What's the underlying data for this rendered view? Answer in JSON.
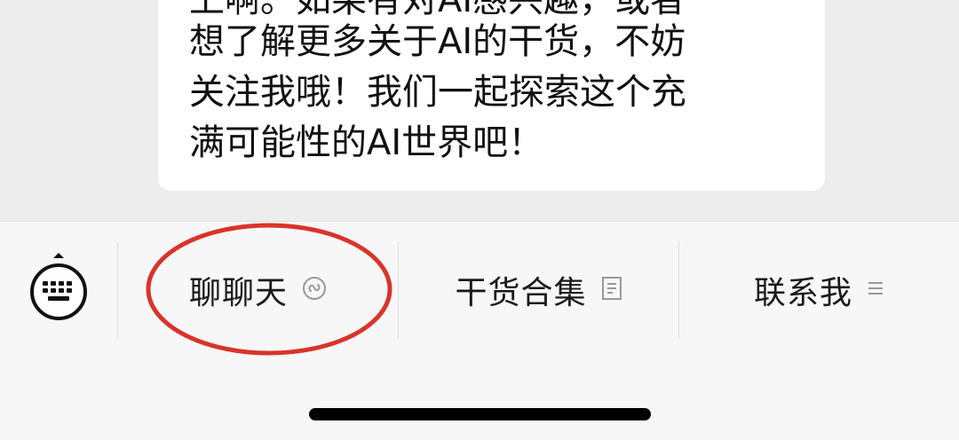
{
  "chat": {
    "message_lines": [
      "上啊。如果有对AI感兴趣，或者",
      "想了解更多关于AI的干货，不妨",
      "关注我哦！我们一起探索这个充",
      "满可能性的AI世界吧！"
    ]
  },
  "menu": {
    "keyboard_toggle_icon": "keyboard-icon",
    "items": [
      {
        "label": "聊聊天",
        "icon": "mini-program-link-icon"
      },
      {
        "label": "干货合集",
        "icon": "document-icon"
      },
      {
        "label": "联系我",
        "icon": "menu-lines-icon"
      }
    ]
  },
  "annotation": {
    "highlight_color": "#d9342b",
    "highlighted_item": "聊聊天"
  }
}
